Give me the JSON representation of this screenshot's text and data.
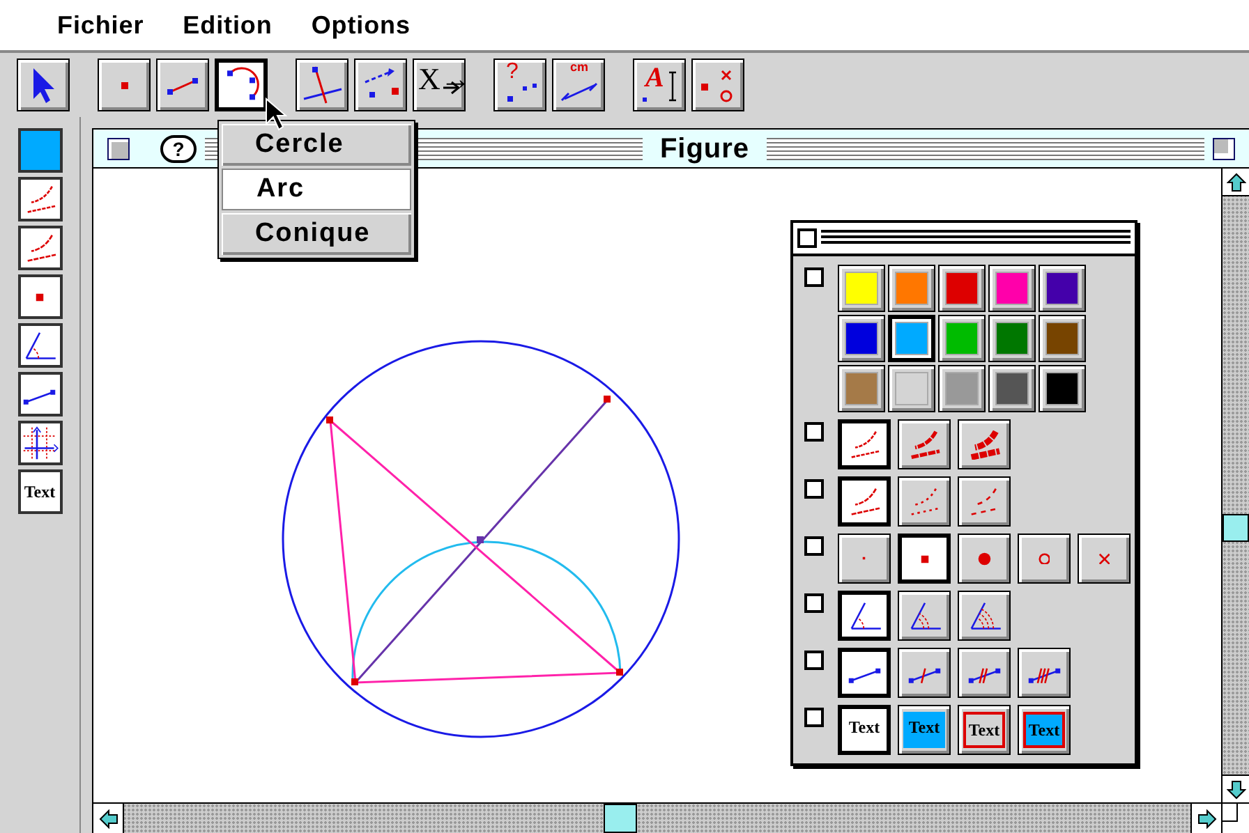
{
  "menu": [
    {
      "label": "Fichier"
    },
    {
      "label": "Edition"
    },
    {
      "label": "Options"
    }
  ],
  "toolbar": [
    {
      "kind": "pointer",
      "selected": false
    },
    {
      "kind": "point",
      "selected": false
    },
    {
      "kind": "segment",
      "selected": false
    },
    {
      "kind": "arc",
      "selected": true
    },
    {
      "kind": "perpendicular",
      "selected": false
    },
    {
      "kind": "transform",
      "selected": false
    },
    {
      "kind": "macro",
      "label": "X→",
      "selected": false
    },
    {
      "kind": "check",
      "label": "?",
      "selected": false
    },
    {
      "kind": "measure",
      "label": "cm",
      "selected": false
    },
    {
      "kind": "label",
      "label": "A",
      "selected": false
    },
    {
      "kind": "hide",
      "selected": false
    }
  ],
  "dropdown": [
    {
      "label": "Cercle",
      "selected": false
    },
    {
      "label": "Arc",
      "selected": true
    },
    {
      "label": "Conique",
      "selected": false
    }
  ],
  "left_palette": [
    {
      "kind": "color",
      "color": "#00aaff"
    },
    {
      "kind": "thickness"
    },
    {
      "kind": "dash"
    },
    {
      "kind": "point"
    },
    {
      "kind": "angle"
    },
    {
      "kind": "segment"
    },
    {
      "kind": "grid"
    },
    {
      "kind": "text",
      "label": "Text"
    }
  ],
  "figure_window": {
    "help": "?",
    "title": "Figure"
  },
  "attributes_palette": {
    "rows": [
      {
        "kind": "color",
        "checked": false,
        "options": [
          {
            "color": "#ffff00",
            "selected": false
          },
          {
            "color": "#ff7700",
            "selected": false
          },
          {
            "color": "#dd0000",
            "selected": false
          },
          {
            "color": "#ff00aa",
            "selected": false
          },
          {
            "color": "#4400aa",
            "selected": false
          },
          {
            "color": "#0000dd",
            "selected": false
          },
          {
            "color": "#00aaff",
            "selected": true
          },
          {
            "color": "#00bb00",
            "selected": false
          },
          {
            "color": "#007700",
            "selected": false
          },
          {
            "color": "#774400",
            "selected": false
          },
          {
            "color": "#a57a48",
            "selected": false
          },
          {
            "color": "#d4d4d4",
            "selected": false
          },
          {
            "color": "#999999",
            "selected": false
          },
          {
            "color": "#555555",
            "selected": false
          },
          {
            "color": "#000000",
            "selected": false
          }
        ]
      },
      {
        "kind": "thickness",
        "checked": false,
        "options": [
          {
            "selected": true
          },
          {
            "selected": false
          },
          {
            "selected": false
          }
        ]
      },
      {
        "kind": "dash",
        "checked": false,
        "options": [
          {
            "selected": true
          },
          {
            "selected": false
          },
          {
            "selected": false
          }
        ]
      },
      {
        "kind": "point",
        "checked": false,
        "options": [
          {
            "selected": false
          },
          {
            "selected": true
          },
          {
            "selected": false
          },
          {
            "selected": false
          },
          {
            "selected": false
          }
        ]
      },
      {
        "kind": "angle",
        "checked": false,
        "options": [
          {
            "selected": true
          },
          {
            "selected": false
          },
          {
            "selected": false
          }
        ]
      },
      {
        "kind": "mark",
        "checked": false,
        "options": [
          {
            "selected": true
          },
          {
            "selected": false
          },
          {
            "selected": false
          },
          {
            "selected": false
          }
        ]
      },
      {
        "kind": "text",
        "checked": false,
        "options": [
          {
            "label": "Text",
            "selected": true
          },
          {
            "label": "Text",
            "selected": false
          },
          {
            "label": "Text",
            "selected": false
          },
          {
            "label": "Text",
            "selected": false
          }
        ]
      }
    ]
  }
}
